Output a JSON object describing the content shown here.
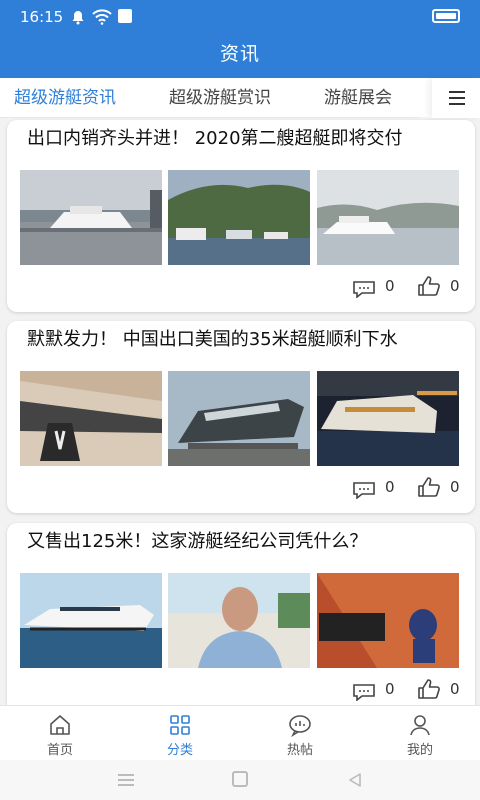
{
  "status_bar": {
    "time": "16:15"
  },
  "header": {
    "title": "资讯"
  },
  "tabs": [
    {
      "label": "超级游艇资讯",
      "active": true
    },
    {
      "label": "超级游艇赏识",
      "active": false
    },
    {
      "label": "游艇展会",
      "active": false
    }
  ],
  "articles": [
    {
      "title": "出口内销齐头并进！ 2020第二艘超艇即将交付",
      "comments": "0",
      "likes": "0"
    },
    {
      "title": "默默发力！ 中国出口美国的35米超艇顺利下水",
      "comments": "0",
      "likes": "0"
    },
    {
      "title": "又售出125米！这家游艇经纪公司凭什么？",
      "comments": "0",
      "likes": "0"
    }
  ],
  "bottom_nav": [
    {
      "label": "首页",
      "icon": "home-icon",
      "active": false
    },
    {
      "label": "分类",
      "icon": "grid-icon",
      "active": true
    },
    {
      "label": "热帖",
      "icon": "chat-bubble-icon",
      "active": false
    },
    {
      "label": "我的",
      "icon": "user-icon",
      "active": false
    }
  ],
  "colors": {
    "brand": "#2f7fd9",
    "active_tab": "#2f7fd9",
    "background": "#f2f2f2"
  }
}
